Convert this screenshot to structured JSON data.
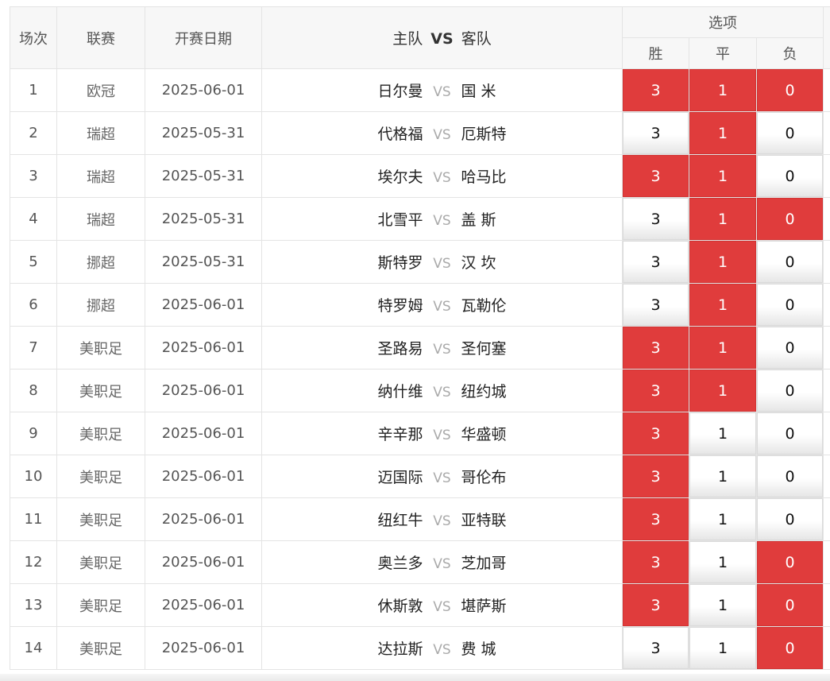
{
  "header": {
    "col_idx": "场次",
    "col_league": "联赛",
    "col_date": "开赛日期",
    "col_home": "主队",
    "col_vs": "VS",
    "col_away": "客队",
    "col_options": "选项",
    "opt_win": "胜",
    "opt_draw": "平",
    "opt_lose": "负"
  },
  "colors": {
    "selected": "#e03c3c",
    "unselected": "#f2f2f2"
  },
  "rows": [
    {
      "idx": "1",
      "league": "欧冠",
      "date": "2025-06-01",
      "home": "日尔曼",
      "vs": "VS",
      "away": "国 米",
      "w": "3",
      "d": "1",
      "l": "0",
      "sel": [
        true,
        true,
        true
      ]
    },
    {
      "idx": "2",
      "league": "瑞超",
      "date": "2025-05-31",
      "home": "代格福",
      "vs": "VS",
      "away": "厄斯特",
      "w": "3",
      "d": "1",
      "l": "0",
      "sel": [
        false,
        true,
        false
      ]
    },
    {
      "idx": "3",
      "league": "瑞超",
      "date": "2025-05-31",
      "home": "埃尔夫",
      "vs": "VS",
      "away": "哈马比",
      "w": "3",
      "d": "1",
      "l": "0",
      "sel": [
        true,
        true,
        false
      ]
    },
    {
      "idx": "4",
      "league": "瑞超",
      "date": "2025-05-31",
      "home": "北雪平",
      "vs": "VS",
      "away": "盖 斯",
      "w": "3",
      "d": "1",
      "l": "0",
      "sel": [
        false,
        true,
        true
      ]
    },
    {
      "idx": "5",
      "league": "挪超",
      "date": "2025-05-31",
      "home": "斯特罗",
      "vs": "VS",
      "away": "汉 坎",
      "w": "3",
      "d": "1",
      "l": "0",
      "sel": [
        false,
        true,
        false
      ]
    },
    {
      "idx": "6",
      "league": "挪超",
      "date": "2025-06-01",
      "home": "特罗姆",
      "vs": "VS",
      "away": "瓦勒伦",
      "w": "3",
      "d": "1",
      "l": "0",
      "sel": [
        false,
        true,
        false
      ]
    },
    {
      "idx": "7",
      "league": "美职足",
      "date": "2025-06-01",
      "home": "圣路易",
      "vs": "VS",
      "away": "圣何塞",
      "w": "3",
      "d": "1",
      "l": "0",
      "sel": [
        true,
        true,
        false
      ]
    },
    {
      "idx": "8",
      "league": "美职足",
      "date": "2025-06-01",
      "home": "纳什维",
      "vs": "VS",
      "away": "纽约城",
      "w": "3",
      "d": "1",
      "l": "0",
      "sel": [
        true,
        true,
        false
      ]
    },
    {
      "idx": "9",
      "league": "美职足",
      "date": "2025-06-01",
      "home": "辛辛那",
      "vs": "VS",
      "away": "华盛顿",
      "w": "3",
      "d": "1",
      "l": "0",
      "sel": [
        true,
        false,
        false
      ]
    },
    {
      "idx": "10",
      "league": "美职足",
      "date": "2025-06-01",
      "home": "迈国际",
      "vs": "VS",
      "away": "哥伦布",
      "w": "3",
      "d": "1",
      "l": "0",
      "sel": [
        true,
        false,
        false
      ]
    },
    {
      "idx": "11",
      "league": "美职足",
      "date": "2025-06-01",
      "home": "纽红牛",
      "vs": "VS",
      "away": "亚特联",
      "w": "3",
      "d": "1",
      "l": "0",
      "sel": [
        true,
        false,
        false
      ]
    },
    {
      "idx": "12",
      "league": "美职足",
      "date": "2025-06-01",
      "home": "奥兰多",
      "vs": "VS",
      "away": "芝加哥",
      "w": "3",
      "d": "1",
      "l": "0",
      "sel": [
        true,
        false,
        true
      ]
    },
    {
      "idx": "13",
      "league": "美职足",
      "date": "2025-06-01",
      "home": "休斯敦",
      "vs": "VS",
      "away": "堪萨斯",
      "w": "3",
      "d": "1",
      "l": "0",
      "sel": [
        true,
        false,
        true
      ]
    },
    {
      "idx": "14",
      "league": "美职足",
      "date": "2025-06-01",
      "home": "达拉斯",
      "vs": "VS",
      "away": "费 城",
      "w": "3",
      "d": "1",
      "l": "0",
      "sel": [
        false,
        false,
        true
      ]
    }
  ]
}
